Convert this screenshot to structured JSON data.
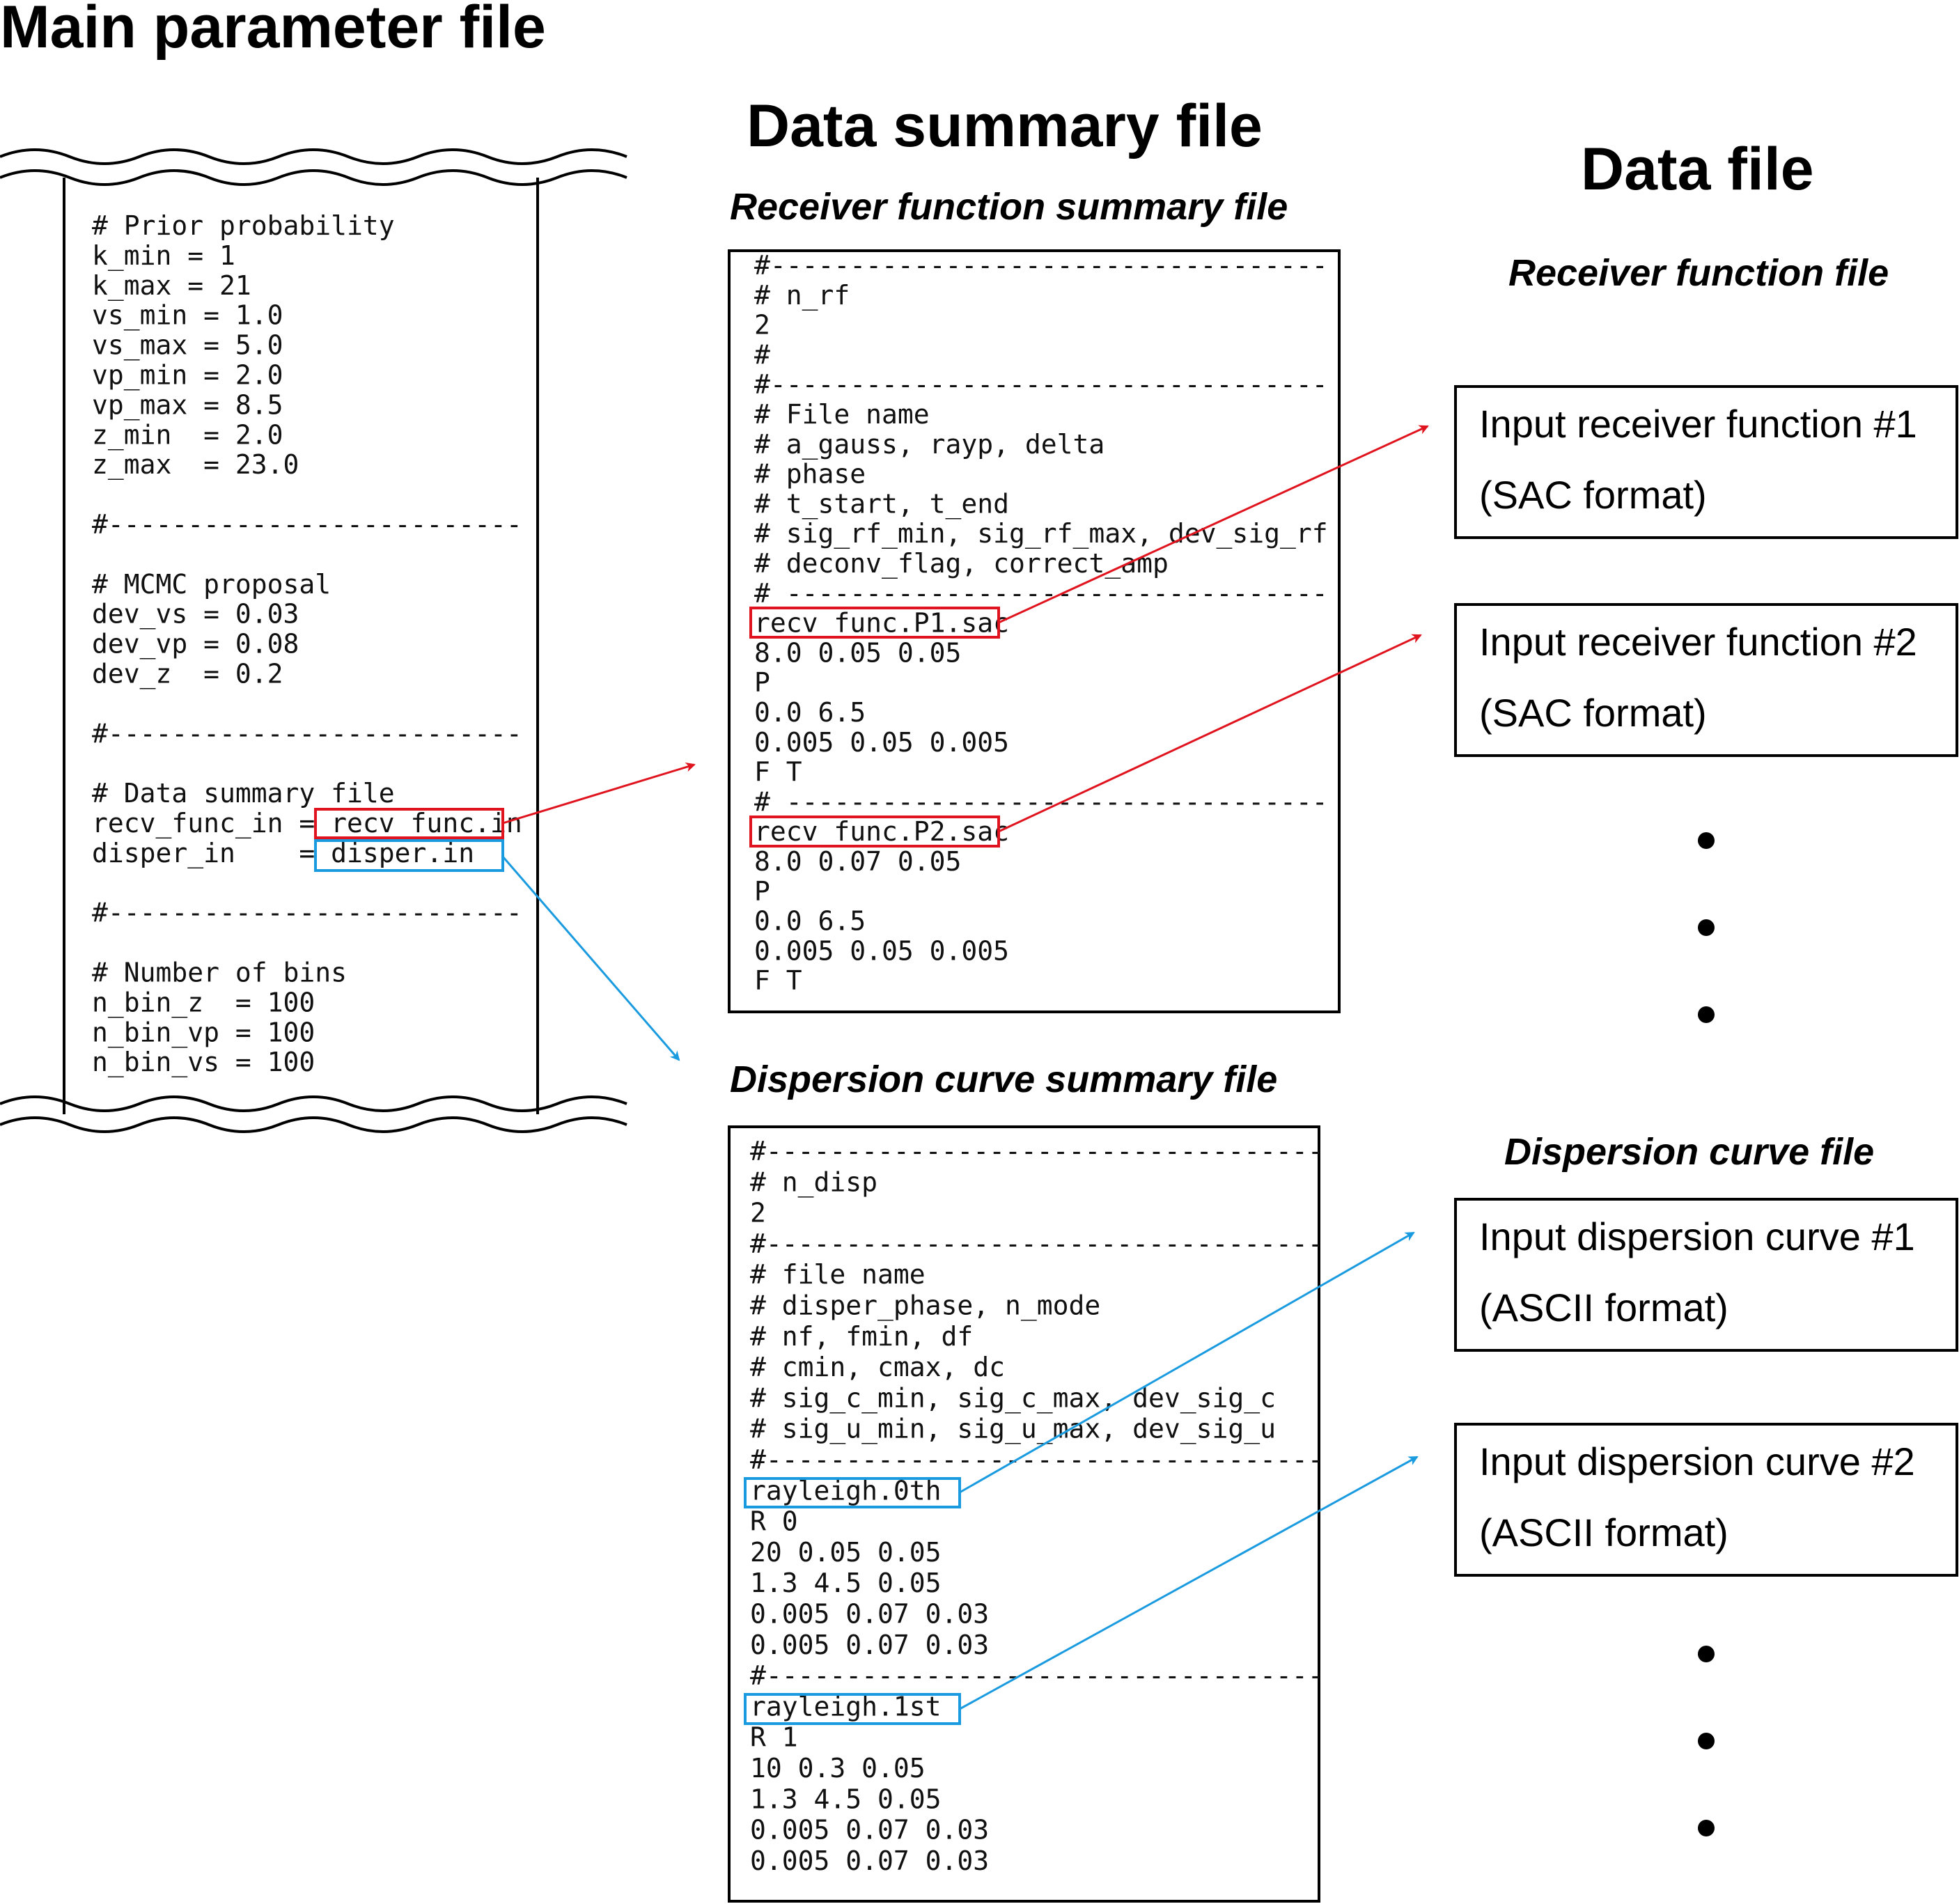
{
  "titles": {
    "main": "Main parameter file",
    "summary": "Data summary file",
    "data": "Data file"
  },
  "subtitles": {
    "rf_summary": "Receiver function summary file",
    "disp_summary": "Dispersion curve summary file",
    "rf_file": "Receiver function file",
    "disp_file": "Dispersion curve file"
  },
  "main_param": {
    "lines": [
      "# Prior probability",
      "k_min = 1",
      "k_max = 21",
      "vs_min = 1.0",
      "vs_max = 5.0",
      "vp_min = 2.0",
      "vp_max = 8.5",
      "z_min  = 2.0",
      "z_max  = 23.0",
      "",
      "#--------------------------",
      "",
      "# MCMC proposal",
      "dev_vs = 0.03",
      "dev_vp = 0.08",
      "dev_z  = 0.2",
      "",
      "#--------------------------",
      "",
      "# Data summary file",
      "recv_func_in = recv_func.in",
      "disper_in    = disper.in",
      "",
      "#--------------------------",
      "",
      "# Number of bins",
      "n_bin_z  = 100",
      "n_bin_vp = 100",
      "n_bin_vs = 100"
    ]
  },
  "rf_summary": {
    "lines": [
      "#-----------------------------------",
      "# n_rf",
      "2",
      "#",
      "#-----------------------------------",
      "# File name",
      "# a_gauss, rayp, delta",
      "# phase",
      "# t_start, t_end",
      "# sig_rf_min, sig_rf_max, dev_sig_rf",
      "# deconv_flag, correct_amp",
      "# ----------------------------------",
      "recv_func.P1.sac",
      "8.0 0.05 0.05",
      "P",
      "0.0 6.5",
      "0.005 0.05 0.005",
      "F T",
      "# ----------------------------------",
      "recv_func.P2.sac",
      "8.0 0.07 0.05",
      "P",
      "0.0 6.5",
      "0.005 0.05 0.005",
      "F T"
    ]
  },
  "disp_summary": {
    "lines": [
      "#-----------------------------------",
      "# n_disp",
      "2",
      "#-----------------------------------",
      "# file name",
      "# disper_phase, n_mode",
      "# nf, fmin, df",
      "# cmin, cmax, dc",
      "# sig_c_min, sig_c_max, dev_sig_c",
      "# sig_u_min, sig_u_max, dev_sig_u",
      "#-----------------------------------",
      "rayleigh.0th",
      "R 0",
      "20 0.05 0.05",
      "1.3 4.5 0.05",
      "0.005 0.07 0.03",
      "0.005 0.07 0.03",
      "#-----------------------------------",
      "rayleigh.1st",
      "R 1",
      "10 0.3 0.05",
      "1.3 4.5 0.05",
      "0.005 0.07 0.03",
      "0.005 0.07 0.03"
    ]
  },
  "rf_files": [
    {
      "line1": "Input receiver function #1",
      "line2": "(SAC format)"
    },
    {
      "line1": "Input receiver function #2",
      "line2": "(SAC format)"
    }
  ],
  "disp_files": [
    {
      "line1": "Input dispersion curve #1",
      "line2": "(ASCII format)"
    },
    {
      "line1": "Input dispersion curve #2",
      "line2": "(ASCII format)"
    }
  ],
  "colors": {
    "red": "#e0141e",
    "blue": "#1a9be0",
    "ink": "#000000"
  }
}
